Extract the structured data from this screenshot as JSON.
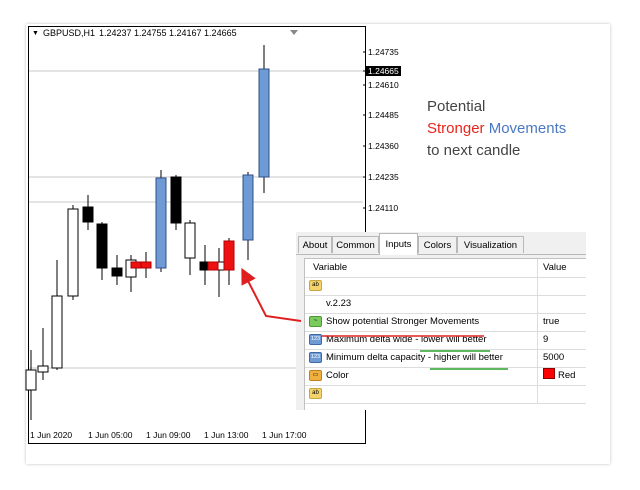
{
  "chart": {
    "symbol": "GBPUSD,H1",
    "ohlc": "1.24237 1.24755 1.24167 1.24665",
    "price_levels": [
      "1.24735",
      "1.24665",
      "1.24610",
      "1.24485",
      "1.24360",
      "1.24235",
      "1.24110"
    ],
    "current_price": "1.24665",
    "time_labels": [
      "1 Jun 2020",
      "1 Jun 05:00",
      "1 Jun 09:00",
      "1 Jun 13:00",
      "1 Jun 17:00"
    ],
    "bull_color": "#ffffff",
    "bear_color": "#000000",
    "highlight_bull": "#6e9bd4",
    "highlight_bear": "#ee1111"
  },
  "promo": {
    "line1": "Potential",
    "word_red": "Stronger",
    "word_blue": "Movements",
    "line3": "to next candle"
  },
  "dialog": {
    "tabs": [
      "About",
      "Common",
      "Inputs",
      "Colors",
      "Visualization"
    ],
    "active_tab": "Inputs",
    "header": {
      "variable": "Variable",
      "value": "Value"
    },
    "rows": [
      {
        "icon": "ab",
        "label": "",
        "value": ""
      },
      {
        "icon": "",
        "label": "v.2.23",
        "value": ""
      },
      {
        "icon": "bool",
        "label": "Show potential Stronger Movements",
        "value": "true"
      },
      {
        "icon": "num",
        "label": "Maximum delta wide - lower will better",
        "value": "9"
      },
      {
        "icon": "num",
        "label": "Minimum delta capacity - higher will better",
        "value": "5000"
      },
      {
        "icon": "color",
        "label": "Color",
        "value": "Red"
      },
      {
        "icon": "ab",
        "label": "",
        "value": ""
      }
    ],
    "icon_texts": {
      "ab": "ab",
      "bool": "~",
      "num": "123",
      "color": "▭"
    }
  }
}
